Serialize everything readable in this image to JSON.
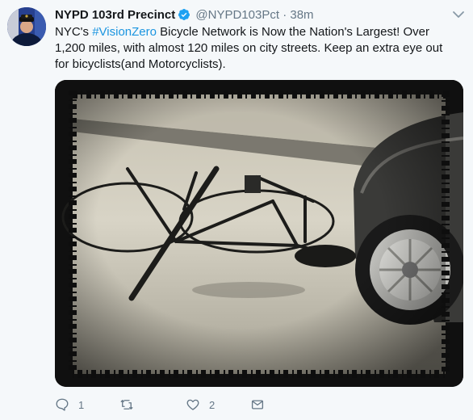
{
  "tweet": {
    "display_name": "NYPD 103rd Precinct",
    "handle": "@NYPD103Pct",
    "separator": "·",
    "time": "38m",
    "text_before": "NYC's ",
    "hashtag": "#VisionZero",
    "text_after": " Bicycle Network is Now the Nation's  Largest! Over 1,200 miles, with almost 120 miles on city streets. Keep an extra eye out for bicyclists(and Motorcyclists).",
    "reply_count": "1",
    "retweet_count": "",
    "like_count": "2"
  },
  "colors": {
    "link": "#1b95e0",
    "secondary_text": "#657786",
    "verified": "#1da1f2",
    "background": "#f5f8fa"
  },
  "icons": {
    "verified": "verified-badge-icon",
    "caret": "chevron-down-icon",
    "reply": "reply-icon",
    "retweet": "retweet-icon",
    "like": "heart-icon",
    "dm": "envelope-icon"
  }
}
